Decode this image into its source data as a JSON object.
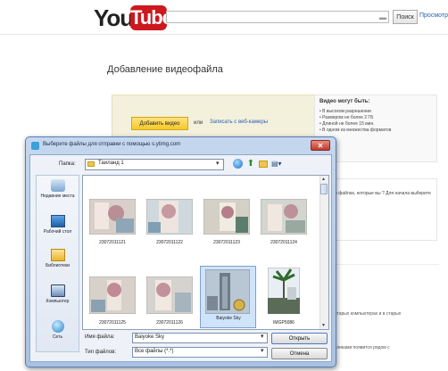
{
  "youtube": {
    "logo_you": "You",
    "logo_tube": "Tube",
    "search_button": "Поиск",
    "browse_link": "Просмотр",
    "upload_title": "Добавление видеофайла",
    "upload_button": "Добавить видео",
    "or_text": "или",
    "webcam_link": "Записать с веб-камеры",
    "requirements": {
      "title": "Видео могут быть:",
      "items": [
        "В высоком разрешении",
        "Размером не более 2 ГБ",
        "Длиной не более 15 мин.",
        "В одном из множества форматов"
      ]
    },
    "side_text_1": "о файлах, которые вы ? Для начала выберите",
    "side_text_2": "старых компьютерах и в старых",
    "side_text_3": "кликами появится рядом с"
  },
  "dialog": {
    "title": "Выберите файлы для отправки с помощью s.ytimg.com",
    "close_icon": "close-icon",
    "look_in_label": "Папка:",
    "look_in_value": "Таиланд 1",
    "toolbar_icons": [
      "globe-icon",
      "up-folder-icon",
      "new-folder-icon",
      "views-menu-icon"
    ],
    "places": [
      {
        "label": "Недавние места",
        "icon": "recent-places-icon"
      },
      {
        "label": "Рабочий стол",
        "icon": "desktop-icon"
      },
      {
        "label": "Библиотеки",
        "icon": "libraries-icon"
      },
      {
        "label": "Компьютер",
        "icon": "computer-icon"
      },
      {
        "label": "Сеть",
        "icon": "network-icon"
      }
    ],
    "files": [
      {
        "name": "23072011121"
      },
      {
        "name": "23072011122"
      },
      {
        "name": "23072011123"
      },
      {
        "name": "23072011124"
      },
      {
        "name": "23072011125"
      },
      {
        "name": "23072011126"
      },
      {
        "name": "Baiyoke Sky"
      },
      {
        "name": "IMGP5086"
      }
    ],
    "selected_file": "Baiyoke Sky",
    "file_name_label": "Имя файла:",
    "file_name_value": "Baiyoke Sky",
    "file_type_label": "Тип файлов:",
    "file_type_value": "Все файлы (*.*)",
    "open_button": "Открыть",
    "cancel_button": "Отмена"
  }
}
